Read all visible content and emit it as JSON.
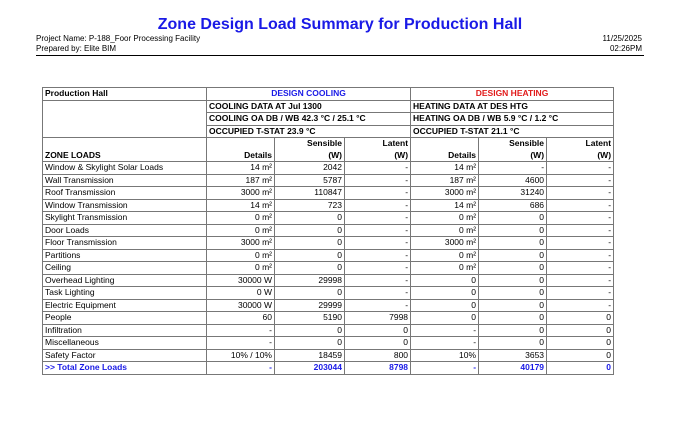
{
  "report": {
    "title": "Zone Design Load Summary for Production Hall",
    "project": "Project Name: P-188_Foor Processing Facility",
    "prepared_by": "Prepared by: Elite BIM",
    "date": "11/25/2025",
    "time": "02:26PM"
  },
  "table": {
    "zone_title": "Production Hall",
    "cooling_header": "DESIGN COOLING",
    "heating_header": "DESIGN HEATING",
    "cooling_lines": [
      "COOLING DATA AT Jul 1300",
      "COOLING OA DB / WB   42.3 °C / 25.1 °C",
      "OCCUPIED T-STAT 23.9 °C"
    ],
    "heating_lines": [
      "HEATING DATA AT DES HTG",
      "HEATING OA DB / WB   5.9 °C / 1.2 °C",
      "OCCUPIED T-STAT 21.1 °C"
    ],
    "zone_loads_label": "ZONE LOADS",
    "col_details": "Details",
    "col_sensible_top": "Sensible",
    "col_sensible_bottom": "(W)",
    "col_latent_top": "Latent",
    "col_latent_bottom": "(W)",
    "rows": [
      {
        "label": "Window & Skylight Solar Loads",
        "c_det": "14 m²",
        "c_sen": "2042",
        "c_lat": "-",
        "h_det": "14 m²",
        "h_sen": "-",
        "h_lat": "-"
      },
      {
        "label": "Wall Transmission",
        "c_det": "187 m²",
        "c_sen": "5787",
        "c_lat": "-",
        "h_det": "187 m²",
        "h_sen": "4600",
        "h_lat": "-"
      },
      {
        "label": "Roof Transmission",
        "c_det": "3000 m²",
        "c_sen": "110847",
        "c_lat": "-",
        "h_det": "3000 m²",
        "h_sen": "31240",
        "h_lat": "-"
      },
      {
        "label": "Window Transmission",
        "c_det": "14 m²",
        "c_sen": "723",
        "c_lat": "-",
        "h_det": "14 m²",
        "h_sen": "686",
        "h_lat": "-"
      },
      {
        "label": "Skylight Transmission",
        "c_det": "0 m²",
        "c_sen": "0",
        "c_lat": "-",
        "h_det": "0 m²",
        "h_sen": "0",
        "h_lat": "-"
      },
      {
        "label": "Door Loads",
        "c_det": "0 m²",
        "c_sen": "0",
        "c_lat": "-",
        "h_det": "0 m²",
        "h_sen": "0",
        "h_lat": "-"
      },
      {
        "label": "Floor Transmission",
        "c_det": "3000 m²",
        "c_sen": "0",
        "c_lat": "-",
        "h_det": "3000 m²",
        "h_sen": "0",
        "h_lat": "-"
      },
      {
        "label": "Partitions",
        "c_det": "0 m²",
        "c_sen": "0",
        "c_lat": "-",
        "h_det": "0 m²",
        "h_sen": "0",
        "h_lat": "-"
      },
      {
        "label": "Ceiling",
        "c_det": "0 m²",
        "c_sen": "0",
        "c_lat": "-",
        "h_det": "0 m²",
        "h_sen": "0",
        "h_lat": "-"
      },
      {
        "label": "Overhead Lighting",
        "c_det": "30000 W",
        "c_sen": "29998",
        "c_lat": "-",
        "h_det": "0",
        "h_sen": "0",
        "h_lat": "-"
      },
      {
        "label": "Task Lighting",
        "c_det": "0 W",
        "c_sen": "0",
        "c_lat": "-",
        "h_det": "0",
        "h_sen": "0",
        "h_lat": "-"
      },
      {
        "label": "Electric Equipment",
        "c_det": "30000 W",
        "c_sen": "29999",
        "c_lat": "-",
        "h_det": "0",
        "h_sen": "0",
        "h_lat": "-"
      },
      {
        "label": "People",
        "c_det": "60",
        "c_sen": "5190",
        "c_lat": "7998",
        "h_det": "0",
        "h_sen": "0",
        "h_lat": "0"
      },
      {
        "label": "Infiltration",
        "c_det": "-",
        "c_sen": "0",
        "c_lat": "0",
        "h_det": "-",
        "h_sen": "0",
        "h_lat": "0"
      },
      {
        "label": "Miscellaneous",
        "c_det": "-",
        "c_sen": "0",
        "c_lat": "0",
        "h_det": "-",
        "h_sen": "0",
        "h_lat": "0"
      },
      {
        "label": "Safety Factor",
        "c_det": "10% / 10%",
        "c_sen": "18459",
        "c_lat": "800",
        "h_det": "10%",
        "h_sen": "3653",
        "h_lat": "0"
      }
    ],
    "total": {
      "label": ">> Total Zone Loads",
      "c_det": "-",
      "c_sen": "203044",
      "c_lat": "8798",
      "h_det": "-",
      "h_sen": "40179",
      "h_lat": "0"
    }
  },
  "colors": {
    "title": "#1a1ae6",
    "cooling": "#1a1ae6",
    "heating": "#e11a1a",
    "total": "#1a1ae6"
  }
}
